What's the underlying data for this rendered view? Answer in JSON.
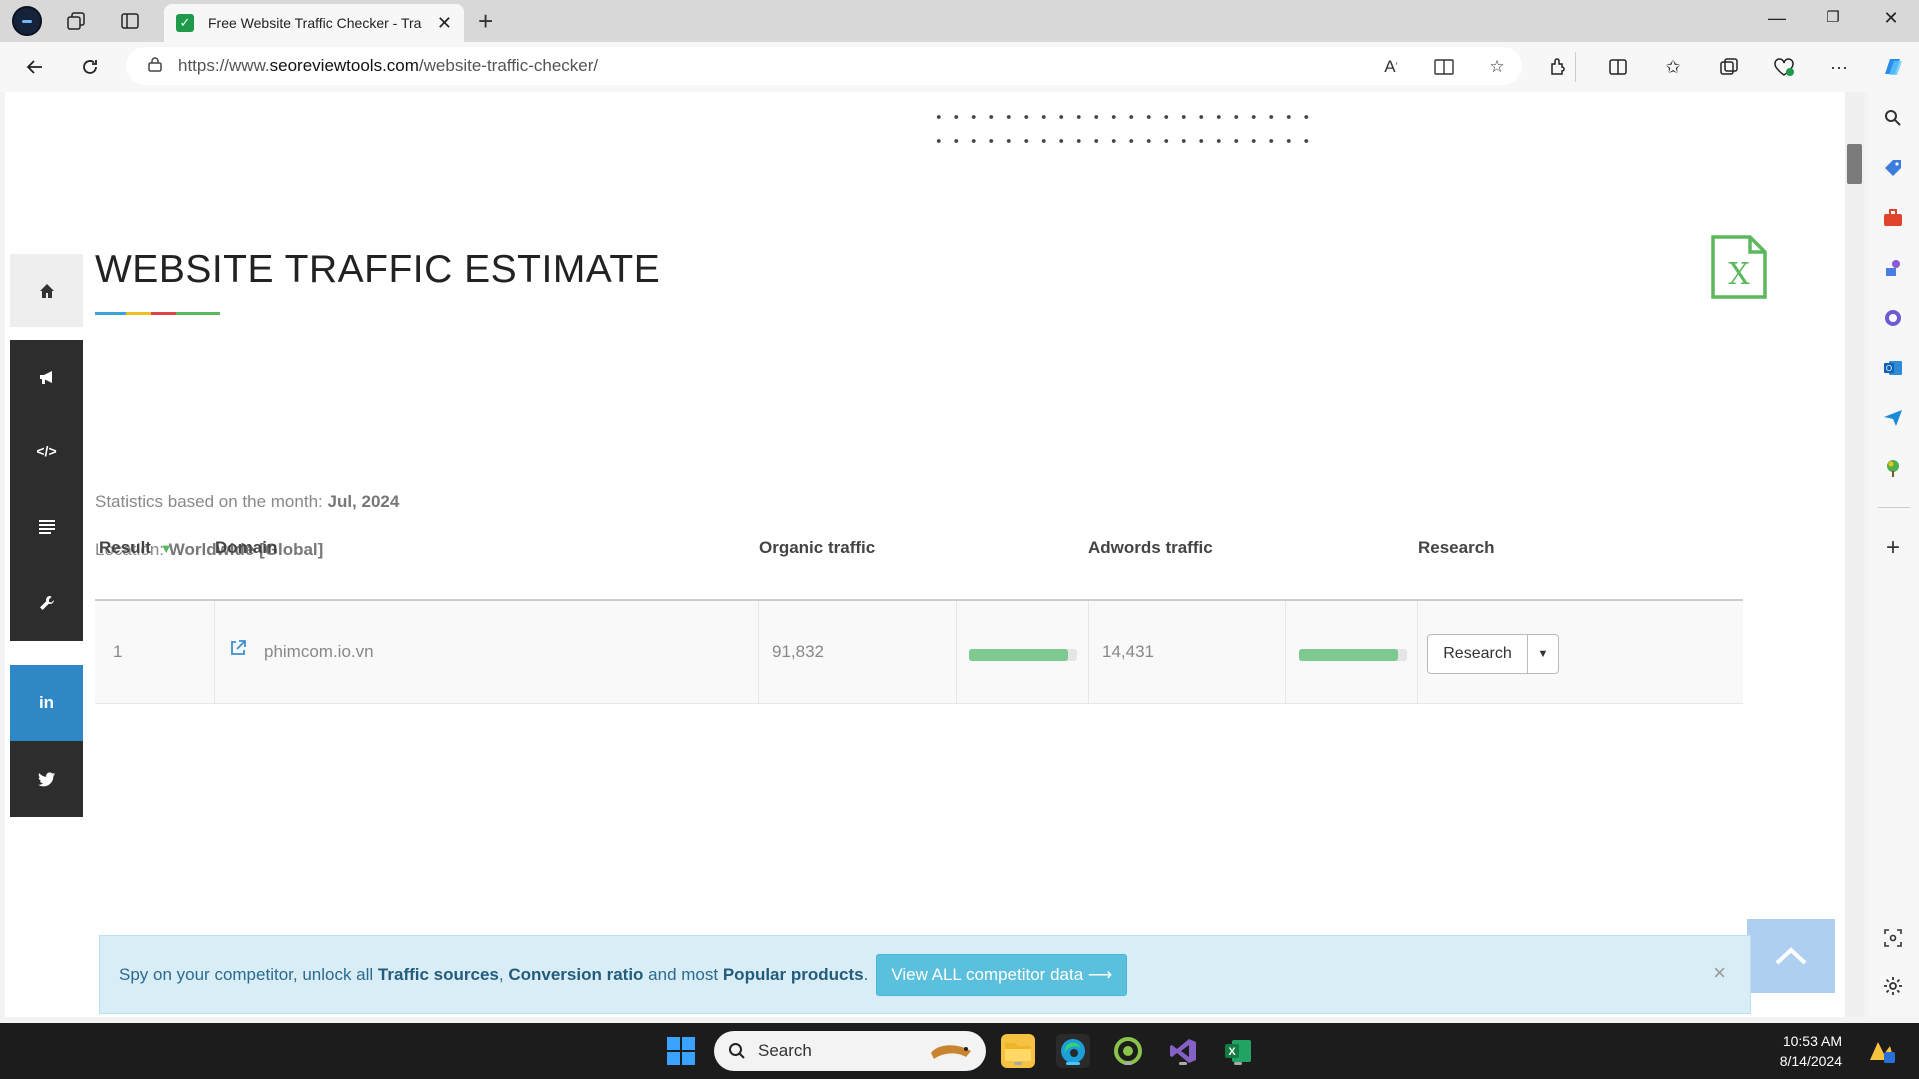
{
  "browser": {
    "tab_title": "Free Website Traffic Checker - Tra",
    "url_prefix": "https://www.",
    "url_domain": "seoreviewtools.com",
    "url_path": "/website-traffic-checker/"
  },
  "page": {
    "title": "WEBSITE TRAFFIC ESTIMATE",
    "stats_label": "Statistics based on the month:",
    "stats_value": "Jul, 2024",
    "location_label": "Location:",
    "location_value": "Worldwide [Global]"
  },
  "table": {
    "headers": {
      "result": "Result",
      "domain": "Domain",
      "organic": "Organic traffic",
      "adwords": "Adwords traffic",
      "research": "Research"
    },
    "rows": [
      {
        "result": "1",
        "domain": "phimcom.io.vn",
        "organic": "91,832",
        "organic_level": 0.92,
        "adwords": "14,431",
        "adwords_level": 0.92,
        "research_label": "Research"
      }
    ]
  },
  "promo": {
    "text1": "Spy on your competitor, unlock all",
    "link1": "Traffic sources",
    "sep": ",",
    "link2": "Conversion ratio",
    "text2": "and most",
    "link3": "Popular products",
    "end": ".",
    "button": "View ALL competitor data ⟶",
    "close": "×"
  },
  "taskbar": {
    "search": "Search",
    "time": "10:53 AM",
    "date": "8/14/2024"
  },
  "colors": {
    "accent_green": "#7ec98f",
    "excel_green": "#5cb85c",
    "promo_bg": "#d9edf7",
    "promo_button": "#5bc0de",
    "linkedin": "#2e88c5",
    "dark_sidebar": "#2d2d2d"
  }
}
